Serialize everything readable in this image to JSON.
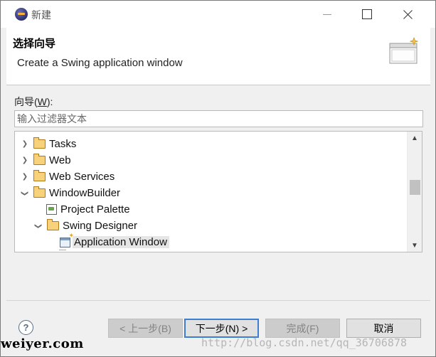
{
  "window": {
    "title": "新建"
  },
  "header": {
    "title": "选择向导",
    "description": "Create a Swing application window"
  },
  "wizard": {
    "label_prefix": "向导(",
    "label_mnemonic": "W",
    "label_suffix": "):",
    "filter_placeholder": "输入过滤器文本"
  },
  "tree": {
    "items": [
      {
        "label": "Tasks",
        "expanded": false
      },
      {
        "label": "Web",
        "expanded": false
      },
      {
        "label": "Web Services",
        "expanded": false
      },
      {
        "label": "WindowBuilder",
        "expanded": true
      },
      {
        "label": "Project Palette",
        "icon": "palette-icon"
      },
      {
        "label": "Swing Designer",
        "expanded": true
      },
      {
        "label": "Application Window",
        "icon": "application-window-icon",
        "selected": true
      }
    ]
  },
  "buttons": {
    "back": "< 上一步(B)",
    "next": "下一步(N) >",
    "finish": "完成(F)",
    "cancel": "取消",
    "help": "?"
  },
  "watermarks": {
    "left": "weiyer.com",
    "right": "http://blog.csdn.net/qq_36706878"
  },
  "colors": {
    "default_button_border": "#3c7fd0",
    "selection_background": "#e5e5e5"
  }
}
